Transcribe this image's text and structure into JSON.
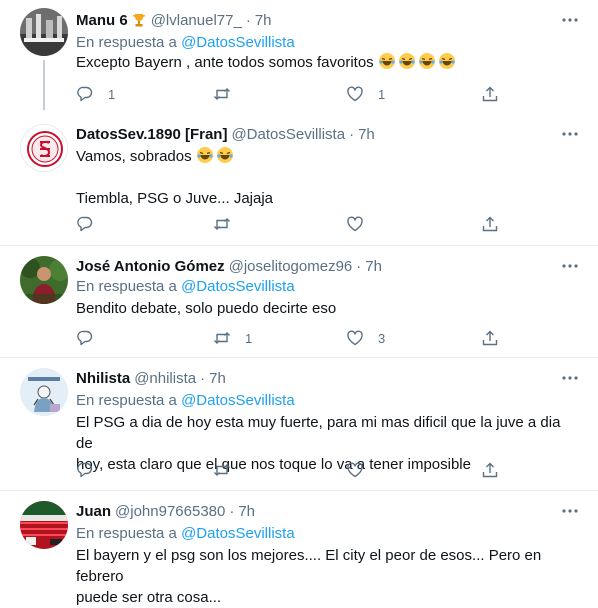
{
  "reply_prefix": "En respuesta a",
  "tweets": [
    {
      "name": "Manu 6",
      "handle": "@lvlanuel77_",
      "time": "7h",
      "reply_to": "@DatosSevillista",
      "body": [
        "Excepto Bayern , ante todos somos favoritos"
      ],
      "reply_count": "1",
      "retweet_count": "",
      "like_count": "1"
    },
    {
      "name": "DatosSev.1890 [Fran]",
      "handle": "@DatosSevillista",
      "time": "7h",
      "body": [
        "Vamos, sobrados",
        "",
        "Tiembla, PSG o Juve...  Jajaja"
      ],
      "reply_count": "",
      "retweet_count": "",
      "like_count": ""
    },
    {
      "name": "José Antonio Gómez",
      "handle": "@joselitogomez96",
      "time": "7h",
      "reply_to": "@DatosSevillista",
      "body": [
        "Bendito debate, solo puedo decirte eso"
      ],
      "reply_count": "",
      "retweet_count": "1",
      "like_count": "3"
    },
    {
      "name": "Nhilista",
      "handle": "@nhilista",
      "time": "7h",
      "reply_to": "@DatosSevillista",
      "body": [
        "El PSG  a dia de hoy esta muy fuerte, para mi mas dificil que la juve a dia de",
        "hoy, esta claro que el que nos toque lo va a tener  imposible"
      ],
      "reply_count": "",
      "retweet_count": "",
      "like_count": ""
    },
    {
      "name": "Juan",
      "handle": "@john97665380",
      "time": "7h",
      "reply_to": "@DatosSevillista",
      "body": [
        "El bayern y el psg son los mejores.... El city el peor de esos... Pero en febrero",
        "puede ser otra cosa..."
      ]
    }
  ],
  "colors": {
    "link": "#1da1f2",
    "muted": "#5b7083",
    "text": "#0f1419",
    "divider": "#e6ecf0"
  },
  "icons": [
    "more-icon",
    "reply-icon",
    "retweet-icon",
    "like-icon",
    "share-icon",
    "trophy-icon",
    "laughing-emoji"
  ]
}
